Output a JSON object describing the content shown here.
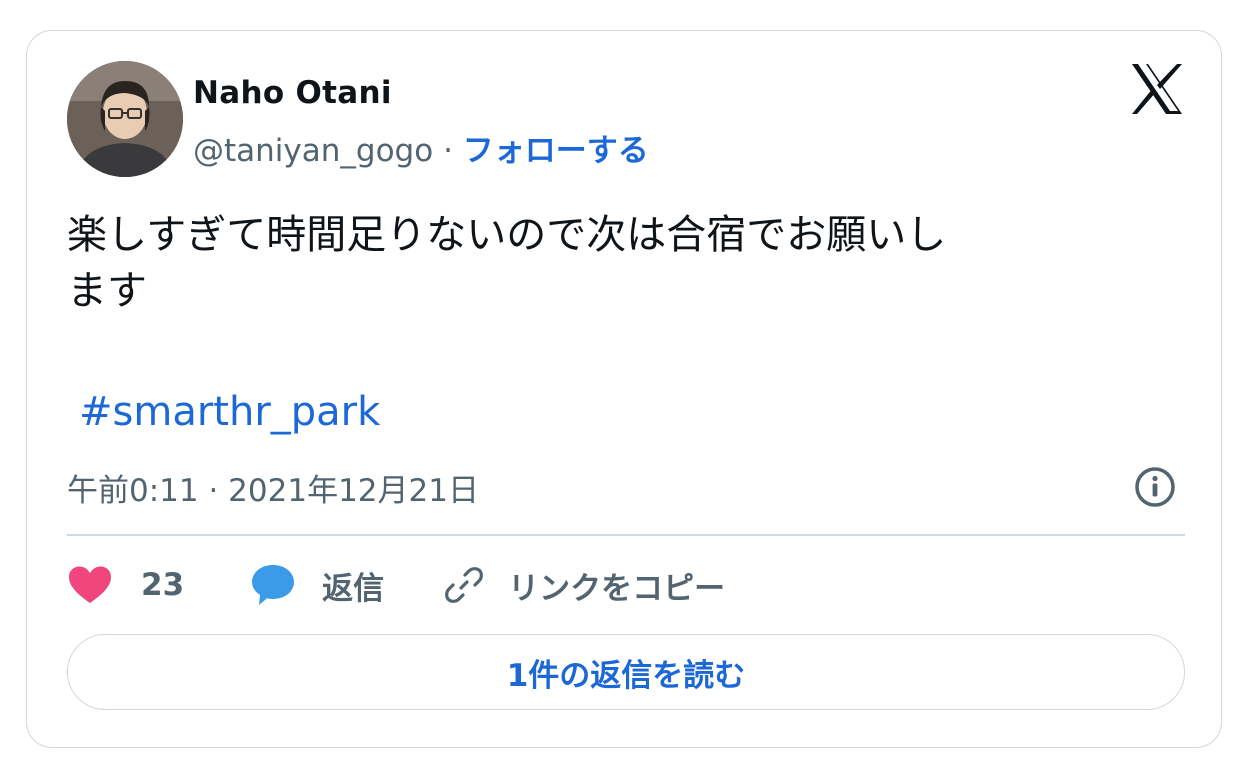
{
  "author": {
    "name": "Naho Otani",
    "handle": "@taniyan_gogo",
    "separator": "·",
    "follow_label": "フォローする",
    "avatar_icon": "profile-photo"
  },
  "brand_icon": "x-logo-icon",
  "tweet": {
    "text_line1": "楽しすぎて時間足りないので次は合宿でお願いし",
    "text_line2": "ます",
    "hashtag": "#smarthr_park",
    "timestamp": "午前0:11 · 2021年12月21日"
  },
  "actions": {
    "like_count": "23",
    "reply_label": "返信",
    "copy_link_label": "リンクをコピー"
  },
  "read_replies_label": "1件の返信を読む",
  "colors": {
    "link": "#1d68d7",
    "text": "#0f1419",
    "muted": "#536471",
    "border": "#cfd9de",
    "heart": "#f0457d",
    "reply_bubble": "#3b9be8"
  }
}
